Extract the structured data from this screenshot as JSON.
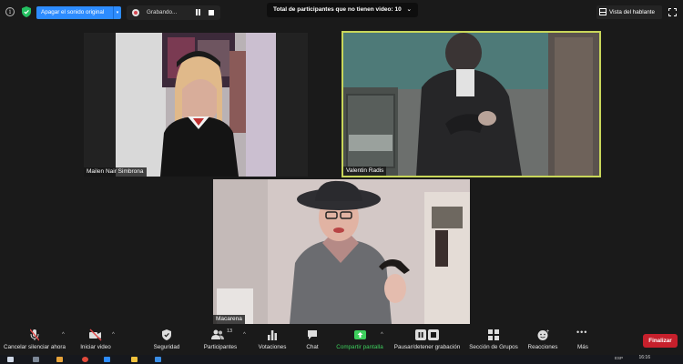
{
  "topbar": {
    "audio_button": "Apagar el sonido original",
    "recording_label": "Grabando...",
    "non_video_count": "Total de participantes que no tienen video: 10",
    "speaker_view": "Vista del hablante"
  },
  "participants": [
    {
      "name": "Mailen Nair Simbrona"
    },
    {
      "name": "Valentin Radis"
    },
    {
      "name": "Macarena"
    }
  ],
  "toolbar": {
    "mute": "Cancelar silenciar ahora",
    "video": "Iniciar video",
    "security": "Seguridad",
    "participants": "Participantes",
    "participant_count": "13",
    "polls": "Votaciones",
    "chat": "Chat",
    "share": "Compartir pantalla",
    "record": "Pausar/detener grabación",
    "breakout": "Sección de Grupos",
    "reactions": "Reacciones",
    "more": "Más",
    "end": "Finalizar"
  },
  "taskbar": {
    "lang": "ESP",
    "time": "16:16"
  },
  "colors": {
    "accent_blue": "#2d8cff",
    "share_green": "#3ecf5d",
    "end_red": "#c7202c",
    "active_speaker": "#c8d65a"
  }
}
